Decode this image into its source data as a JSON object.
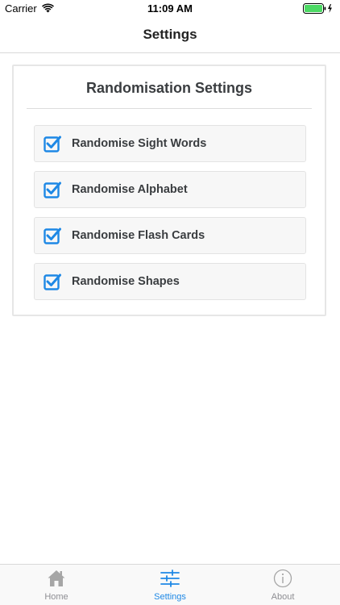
{
  "status_bar": {
    "carrier": "Carrier",
    "time": "11:09 AM",
    "icons": [
      "wifi-icon",
      "battery-icon"
    ]
  },
  "nav": {
    "title": "Settings"
  },
  "panel": {
    "title": "Randomisation Settings",
    "options": [
      {
        "label": "Randomise Sight Words",
        "checked": true
      },
      {
        "label": "Randomise Alphabet",
        "checked": true
      },
      {
        "label": "Randomise Flash Cards",
        "checked": true
      },
      {
        "label": "Randomise Shapes",
        "checked": true
      }
    ]
  },
  "tabs": [
    {
      "label": "Home",
      "icon": "home-icon",
      "active": false
    },
    {
      "label": "Settings",
      "icon": "sliders-icon",
      "active": true
    },
    {
      "label": "About",
      "icon": "info-icon",
      "active": false
    }
  ],
  "colors": {
    "accent": "#1e88e5",
    "inactive": "#a6a6a6",
    "text": "#3a3d40"
  }
}
